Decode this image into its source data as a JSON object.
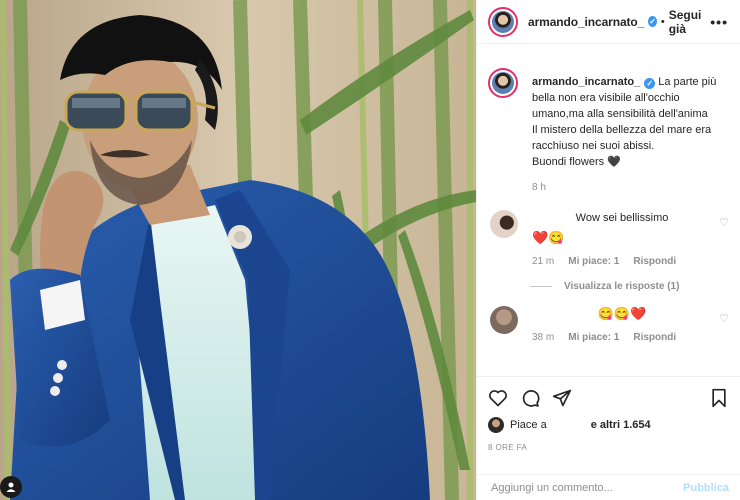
{
  "post": {
    "username": "armando_incarnato_",
    "follow_separator": "•",
    "follow_state": "Segui già",
    "more_label": "•••",
    "caption": "La parte più bella non era visibile all'occhio umano,ma alla sensibilità dell'anima\nIl mistero della bellezza del mare era racchiuso nei suoi abissi.\nBuondi flowers 🖤",
    "caption_time": "8 h",
    "likes_prefix": "Piace a",
    "likes_suffix": "e altri 1.654",
    "post_time": "8 ORE FA"
  },
  "comments": [
    {
      "text": "Wow sei bellissimo",
      "emoji": "❤️😋",
      "time": "21 m",
      "likes": "Mi piace: 1",
      "reply": "Rispondi",
      "view_replies": "Visualizza le risposte (1)"
    },
    {
      "text": "",
      "emoji": "😋😋❤️",
      "time": "38 m",
      "likes": "Mi piace: 1",
      "reply": "Rispondi"
    }
  ],
  "composer": {
    "placeholder": "Aggiungi un commento...",
    "publish": "Pubblica"
  },
  "icons": [
    "heart-icon",
    "comment-icon",
    "share-icon",
    "bookmark-icon",
    "verified-badge-icon",
    "more-options-icon"
  ],
  "colors": {
    "verified": "#3897f0",
    "publish": "#b2dffc",
    "muted": "#8e8e8e",
    "jacket": "#1f4e9b"
  }
}
